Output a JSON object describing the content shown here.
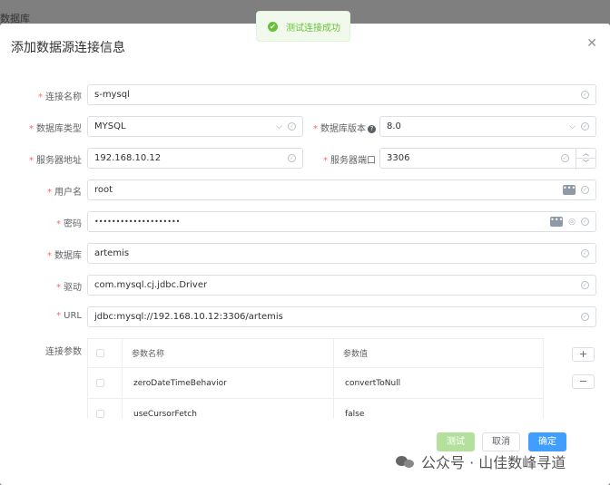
{
  "background": {
    "title": "数据库"
  },
  "toast": {
    "text": "测试连接成功",
    "color": "#67c23a"
  },
  "dialog": {
    "title": "添加数据源连接信息",
    "close": "✕",
    "fields": {
      "conn_name": {
        "label": "连接名称",
        "value": "s-mysql"
      },
      "db_type": {
        "label": "数据库类型",
        "value": "MYSQL"
      },
      "db_version": {
        "label": "数据库版本",
        "help": "?",
        "value": "8.0"
      },
      "server_addr": {
        "label": "服务器地址",
        "value": "192.168.10.12"
      },
      "server_port": {
        "label": "服务器端口",
        "value": "3306"
      },
      "username": {
        "label": "用户名",
        "value": "root"
      },
      "password": {
        "label": "密码",
        "value": "••••••••••••••••••••"
      },
      "database": {
        "label": "数据库",
        "value": "artemis"
      },
      "driver": {
        "label": "驱动",
        "value": "com.mysql.cj.jdbc.Driver"
      },
      "url": {
        "label": "URL",
        "value": "jdbc:mysql://192.168.10.12:3306/artemis"
      }
    },
    "params": {
      "label": "连接参数",
      "headers": [
        "参数名称",
        "参数值"
      ],
      "rows": [
        {
          "name": "zeroDateTimeBehavior",
          "value": "convertToNull"
        },
        {
          "name": "useCursorFetch",
          "value": "false"
        }
      ],
      "add": "+",
      "remove": "−"
    },
    "buttons": {
      "test": "测试",
      "cancel": "取消",
      "confirm": "确定"
    }
  },
  "watermark": "公众号 · 山佳数峰寻道",
  "colors": {
    "primary": "#409eff",
    "success": "#67c23a",
    "required": "#f56c6c"
  }
}
